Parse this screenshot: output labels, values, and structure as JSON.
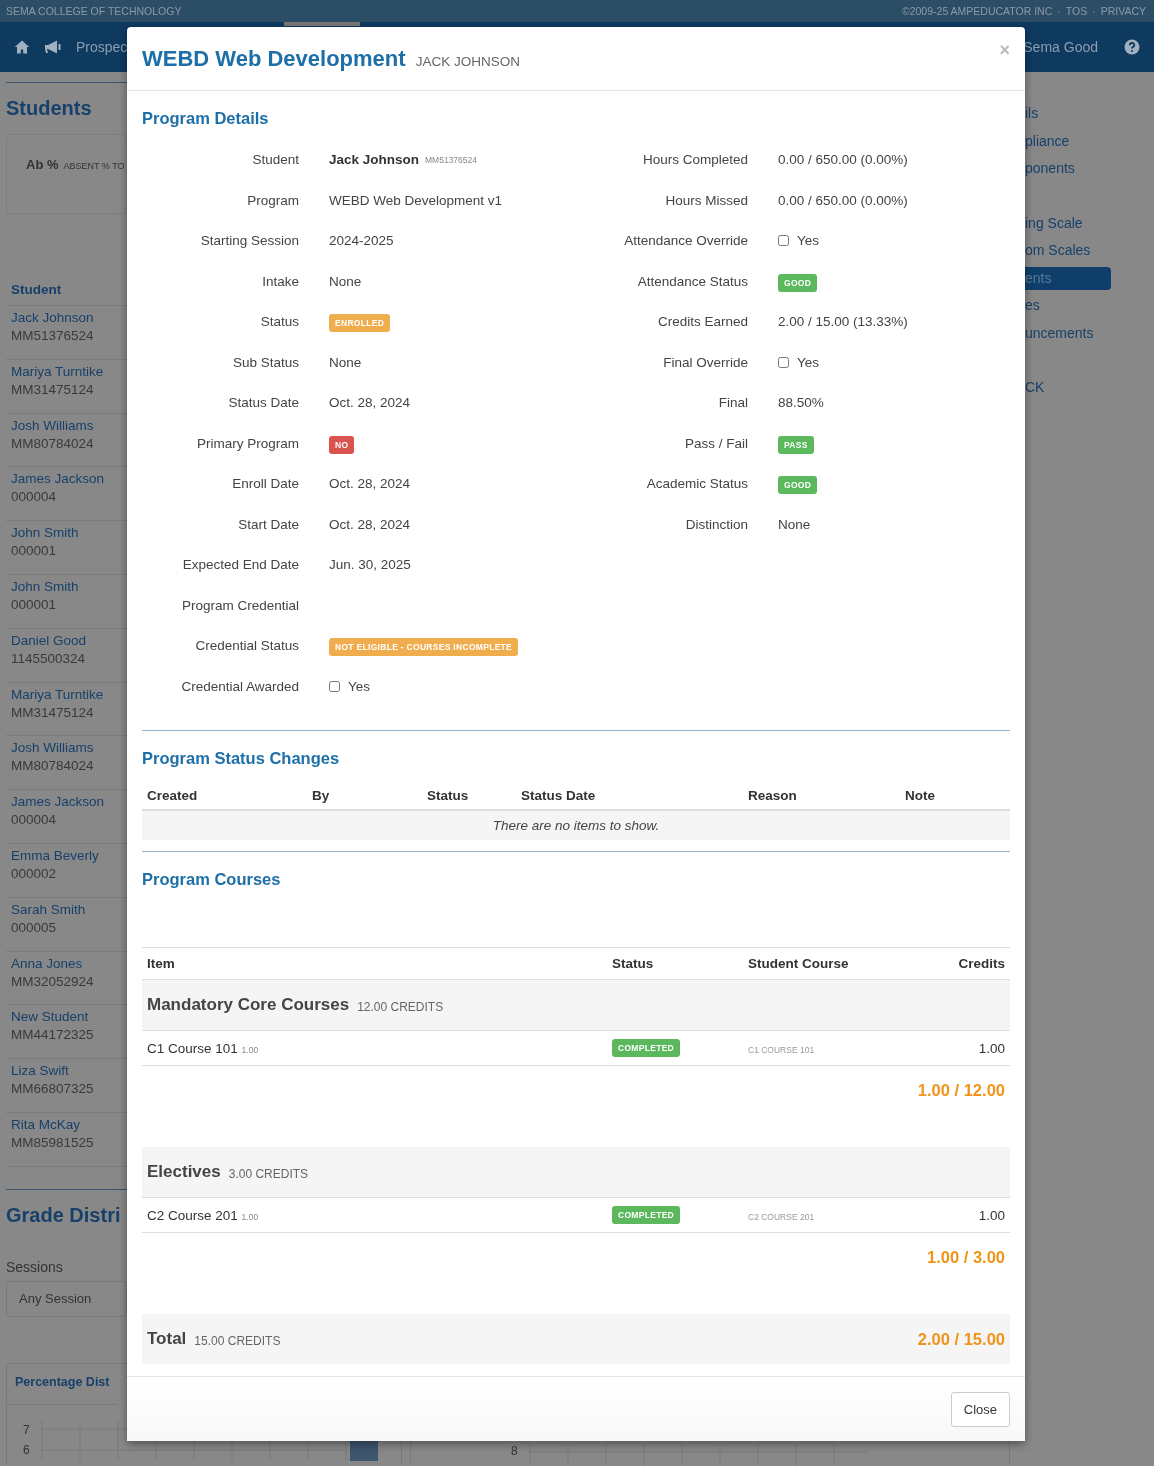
{
  "top_bar": {
    "school": "SEMA COLLEGE OF TECHNOLOGY",
    "separator": "·",
    "links": [
      "©2009-25 AMPEDUCATOR INC",
      "TOS",
      "PRIVACY"
    ]
  },
  "navbar": {
    "nav_item": "Prospec",
    "user": "Sema Good"
  },
  "background": {
    "heading": "Students",
    "stat_card": {
      "label": "Ab %",
      "caption": "ABSENT % TO"
    },
    "list_header": "Student",
    "students": [
      {
        "name": "Jack Johnson",
        "id": "MM51376524"
      },
      {
        "name": "Mariya Turntike",
        "id": "MM31475124"
      },
      {
        "name": "Josh Williams",
        "id": "MM80784024"
      },
      {
        "name": "James Jackson",
        "id": "000004"
      },
      {
        "name": "John Smith",
        "id": "000001"
      },
      {
        "name": "John Smith",
        "id": "000001"
      },
      {
        "name": "Daniel Good",
        "id": "1145500324"
      },
      {
        "name": "Mariya Turntike",
        "id": "MM31475124"
      },
      {
        "name": "Josh Williams",
        "id": "MM80784024"
      },
      {
        "name": "James Jackson",
        "id": "000004"
      },
      {
        "name": "Emma Beverly",
        "id": "000002"
      },
      {
        "name": "Sarah Smith",
        "id": "000005"
      },
      {
        "name": "Anna Jones",
        "id": "MM32052924"
      },
      {
        "name": "New Student",
        "id": "MM44172325"
      },
      {
        "name": "Liza Swift",
        "id": "MM66807325"
      },
      {
        "name": "Rita McKay",
        "id": "MM85981525"
      }
    ],
    "section_heading": "Grade Distri",
    "sessions_label": "Sessions",
    "sessions_select": "Any Session",
    "charts": [
      {
        "title": "Percentage Dist",
        "ticks": [
          "7",
          "6"
        ]
      },
      {
        "ticks": [
          "8"
        ]
      }
    ],
    "side_nav": [
      [
        {
          "label": "ils",
          "selected": false
        },
        {
          "label": "pliance",
          "selected": false
        },
        {
          "label": "ponents",
          "selected": false
        }
      ],
      [
        {
          "label": "ing Scale",
          "selected": false
        },
        {
          "label": "om Scales",
          "selected": false
        },
        {
          "label": "ents",
          "selected": true
        },
        {
          "label": "es",
          "selected": false
        },
        {
          "label": "uncements",
          "selected": false
        }
      ],
      [
        {
          "label": "CK",
          "selected": false
        }
      ]
    ]
  },
  "modal": {
    "title": "WEBD Web Development",
    "subtitle": "JACK JOHNSON",
    "close_icon": "×",
    "details_heading": "Program Details",
    "details_left": [
      {
        "label": "Student",
        "kind": "student",
        "value": "Jack Johnson",
        "note": "MM51376524"
      },
      {
        "label": "Program",
        "kind": "text",
        "value": "WEBD Web Development v1"
      },
      {
        "label": "Starting Session",
        "kind": "text",
        "value": "2024-2025"
      },
      {
        "label": "Intake",
        "kind": "text",
        "value": "None"
      },
      {
        "label": "Status",
        "kind": "badge",
        "value": "ENROLLED",
        "color": "#f0ad4e"
      },
      {
        "label": "Sub Status",
        "kind": "text",
        "value": "None"
      },
      {
        "label": "Status Date",
        "kind": "text",
        "value": "Oct. 28, 2024"
      },
      {
        "label": "Primary Program",
        "kind": "badge",
        "value": "NO",
        "color": "#d9534f"
      },
      {
        "label": "Enroll Date",
        "kind": "text",
        "value": "Oct. 28, 2024"
      },
      {
        "label": "Start Date",
        "kind": "text",
        "value": "Oct. 28, 2024"
      },
      {
        "label": "Expected End Date",
        "kind": "text",
        "value": "Jun. 30, 2025"
      },
      {
        "label": "Program Credential",
        "kind": "none"
      },
      {
        "label": "Credential Status",
        "kind": "badge",
        "value": "NOT ELIGIBLE - COURSES INCOMPLETE",
        "color": "#f0ad4e"
      },
      {
        "label": "Credential Awarded",
        "kind": "checkbox",
        "value": "Yes",
        "checked": false
      }
    ],
    "details_right": [
      {
        "label": "Hours Completed",
        "kind": "text",
        "value": "0.00 / 650.00 (0.00%)"
      },
      {
        "label": "Hours Missed",
        "kind": "text",
        "value": "0.00 / 650.00 (0.00%)"
      },
      {
        "label": "Attendance Override",
        "kind": "checkbox",
        "value": "Yes",
        "checked": false
      },
      {
        "label": "Attendance Status",
        "kind": "badge",
        "value": "GOOD",
        "color": "#5cb85c"
      },
      {
        "label": "Credits Earned",
        "kind": "text",
        "value": "2.00 / 15.00 (13.33%)"
      },
      {
        "label": "Final Override",
        "kind": "checkbox",
        "value": "Yes",
        "checked": false
      },
      {
        "label": "Final",
        "kind": "text",
        "value": "88.50%"
      },
      {
        "label": "Pass / Fail",
        "kind": "badge",
        "value": "PASS",
        "color": "#5cb85c"
      },
      {
        "label": "Academic Status",
        "kind": "badge",
        "value": "GOOD",
        "color": "#5cb85c"
      },
      {
        "label": "Distinction",
        "kind": "text",
        "value": "None"
      }
    ],
    "status_changes": {
      "heading": "Program Status Changes",
      "columns": [
        "Created",
        "By",
        "Status",
        "Status Date",
        "Reason",
        "Note"
      ],
      "empty_message": "There are no items to show."
    },
    "courses": {
      "heading": "Program Courses",
      "columns": [
        "Item",
        "Status",
        "Student Course",
        "Credits"
      ],
      "groups": [
        {
          "title": "Mandatory Core Courses",
          "credits": "12.00 CREDITS",
          "rows": [
            {
              "name": "C1 Course 101",
              "credit": "1.00",
              "status": "COMPLETED",
              "student_course": "C1 COURSE 101",
              "credits": "1.00"
            }
          ],
          "subtotal": "1.00 / 12.00"
        },
        {
          "title": "Electives",
          "credits": "3.00 CREDITS",
          "rows": [
            {
              "name": "C2 Course 201",
              "credit": "1.00",
              "status": "COMPLETED",
              "student_course": "C2 COURSE 201",
              "credits": "1.00"
            }
          ],
          "subtotal": "1.00 / 3.00"
        }
      ],
      "total": {
        "label": "Total",
        "credits": "15.00 CREDITS",
        "value": "2.00 / 15.00"
      }
    },
    "close_button": "Close"
  }
}
